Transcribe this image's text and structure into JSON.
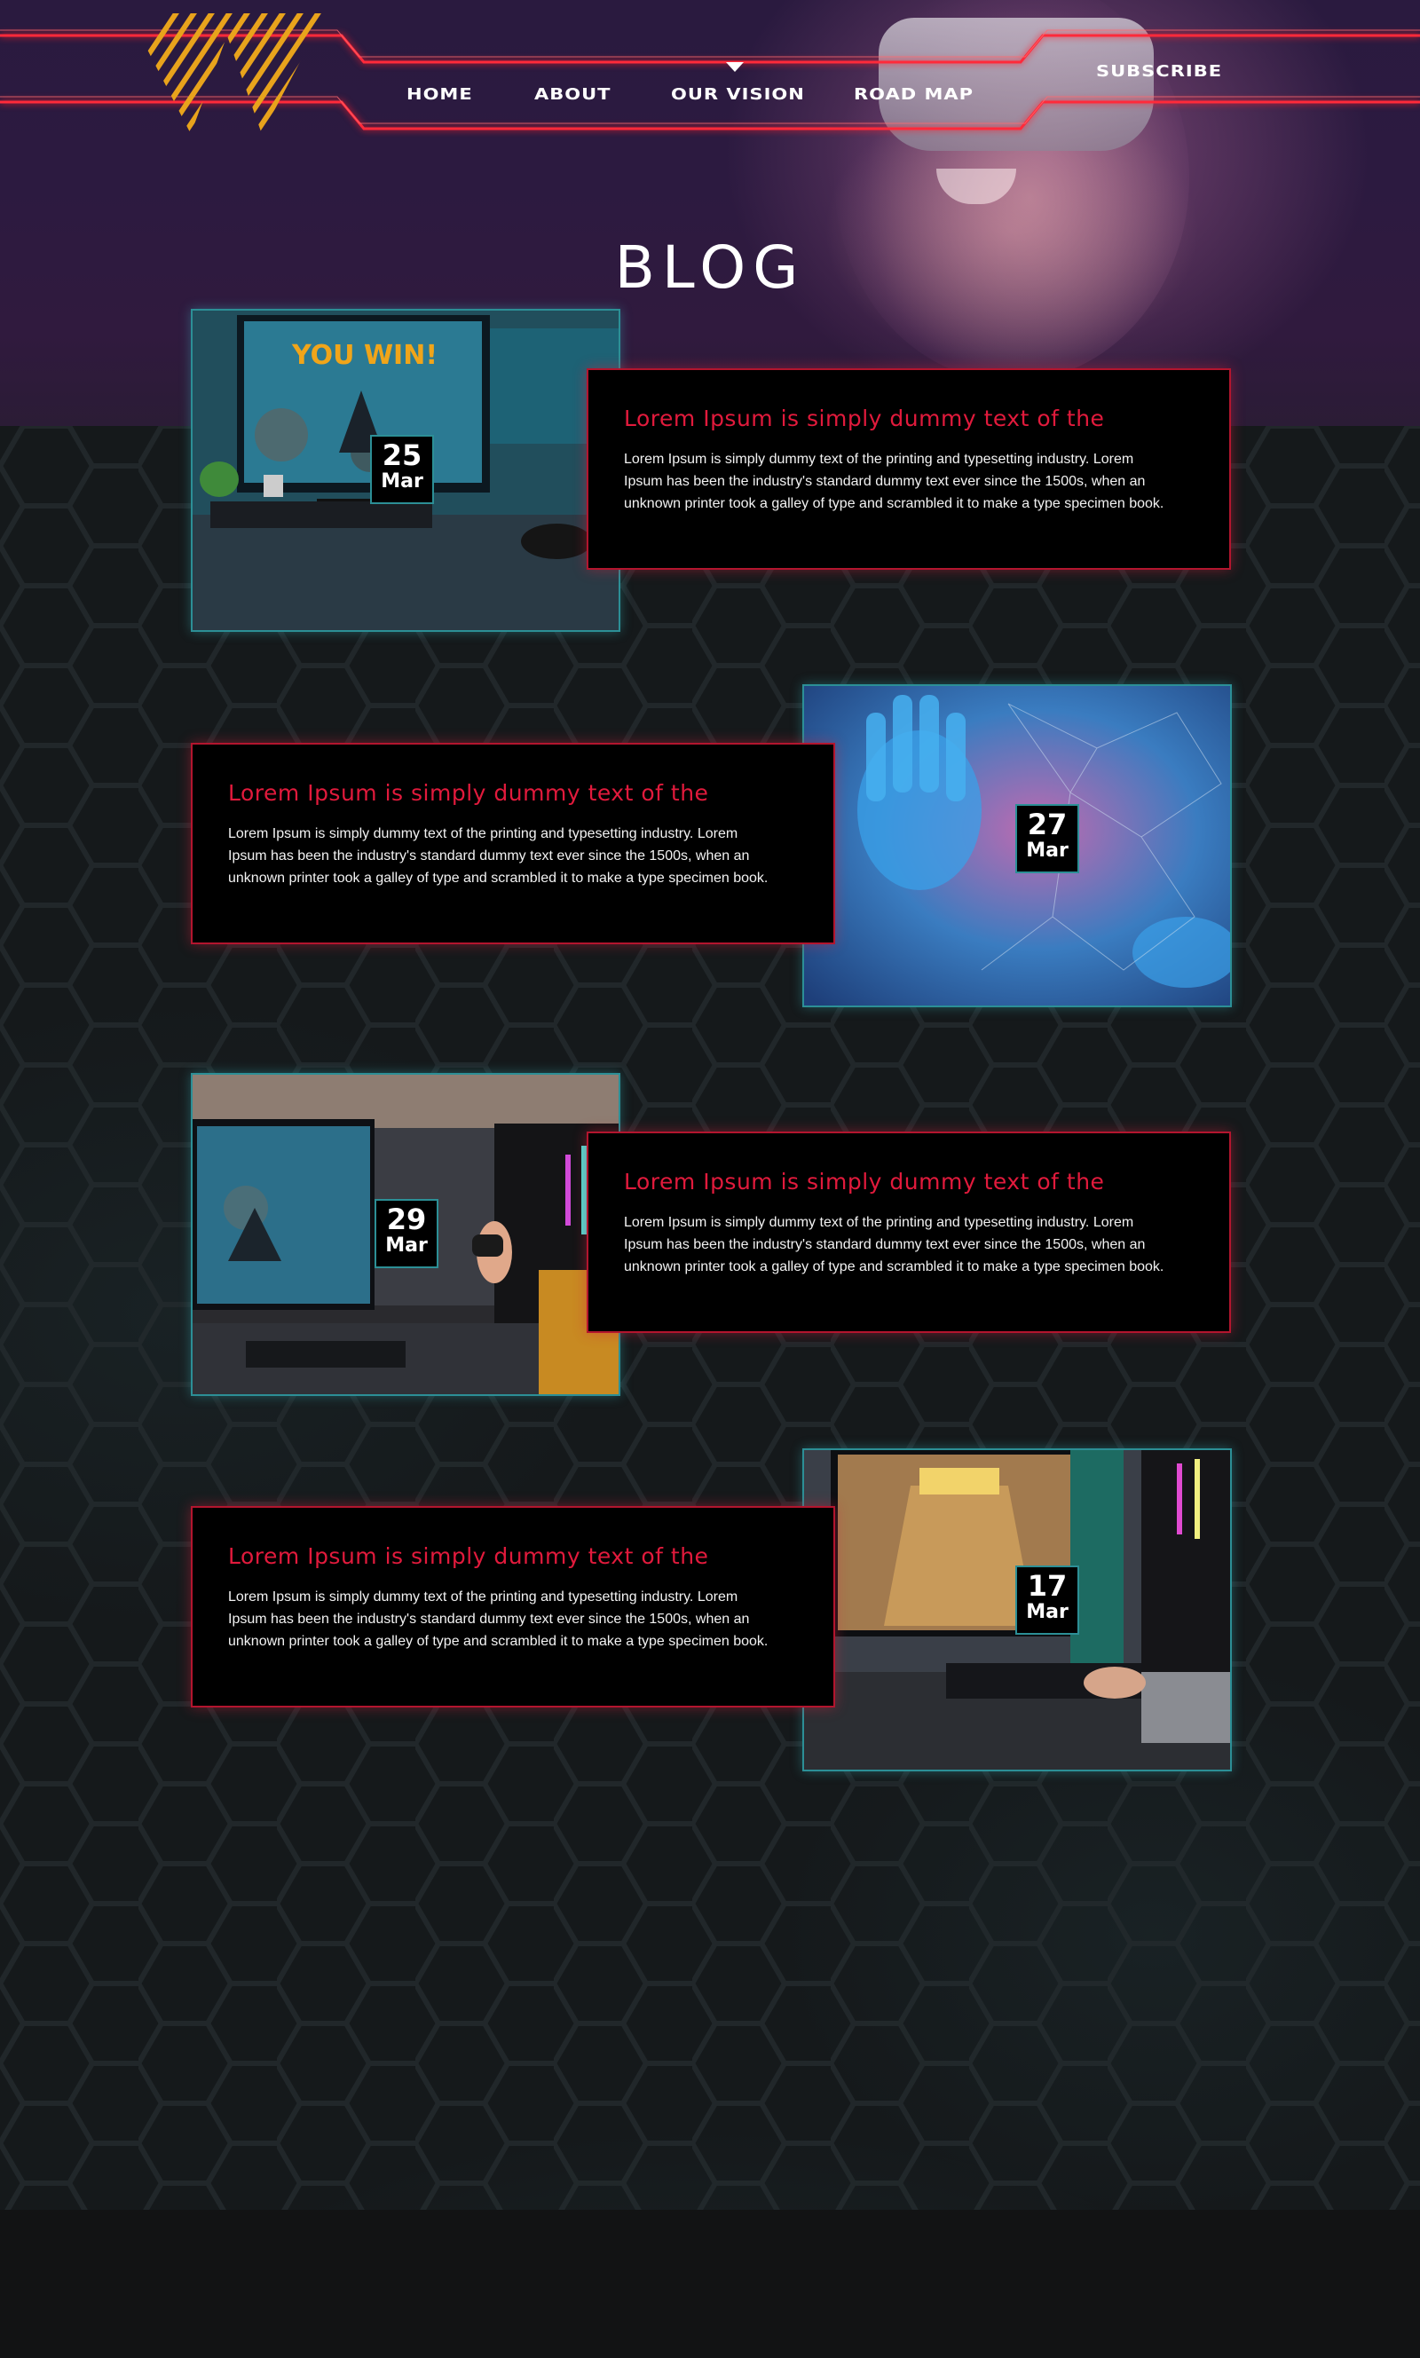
{
  "nav": {
    "items": [
      "HOME",
      "ABOUT",
      "OUR VISION",
      "ROAD MAP"
    ],
    "active_index": 2,
    "subscribe": "SUBSCRIBE"
  },
  "page_title": "BLOG",
  "posts": [
    {
      "title": "Lorem Ipsum is simply dummy text of the",
      "body": "Lorem Ipsum is simply dummy text of the printing and typesetting industry. Lorem Ipsum has been the industry's standard dummy text ever since the 1500s, when an unknown printer took a galley of type and scrambled it to make a type specimen book.",
      "day": "25",
      "month": "Mar",
      "screen_text": "YOU WIN!"
    },
    {
      "title": "Lorem Ipsum is simply dummy text of the",
      "body": "Lorem Ipsum is simply dummy text of the printing and typesetting industry. Lorem Ipsum has been the industry's standard dummy text ever since the 1500s, when an unknown printer took a galley of type and scrambled it to make a type specimen book.",
      "day": "27",
      "month": "Mar"
    },
    {
      "title": "Lorem Ipsum is simply dummy text of the",
      "body": "Lorem Ipsum is simply dummy text of the printing and typesetting industry. Lorem Ipsum has been the industry's standard dummy text ever since the 1500s, when an unknown printer took a galley of type and scrambled it to make a type specimen book.",
      "day": "29",
      "month": "Mar"
    },
    {
      "title": "Lorem Ipsum is simply dummy text of the",
      "body": "Lorem Ipsum is simply dummy text of the printing and typesetting industry. Lorem Ipsum has been the industry's standard dummy text ever since the 1500s, when an unknown printer took a galley of type and scrambled it to make a type specimen book.",
      "day": "17",
      "month": "Mar"
    }
  ],
  "colors": {
    "accent_red": "#e11a3c",
    "accent_teal": "#2c8f96",
    "logo_gold": "#e8a31c",
    "background": "#15191b"
  }
}
